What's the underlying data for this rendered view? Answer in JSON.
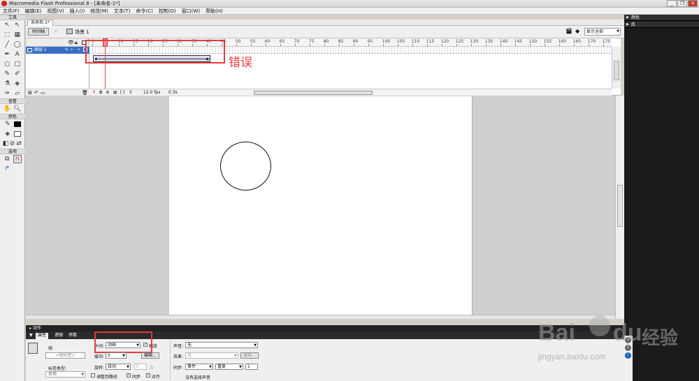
{
  "window": {
    "title": "Macromedia Flash Professional 8 - [未命名-1*]",
    "buttons": [
      "_",
      "❐",
      "✕"
    ]
  },
  "menu": [
    "文件(F)",
    "编辑(E)",
    "视图(V)",
    "插入(I)",
    "修改(M)",
    "文本(T)",
    "命令(C)",
    "控制(O)",
    "窗口(W)",
    "帮助(H)"
  ],
  "tools": {
    "title": "工具",
    "view_title": "查看",
    "colors_title": "颜色",
    "options_title": "选项",
    "rows": [
      [
        "arrow-icon",
        "subselect-icon"
      ],
      [
        "free-transform-icon",
        "fill-transform-icon"
      ],
      [
        "line-icon",
        "lasso-icon"
      ],
      [
        "pen-icon",
        "text-icon"
      ],
      [
        "oval-icon",
        "rectangle-icon"
      ],
      [
        "pencil-icon",
        "brush-icon"
      ],
      [
        "ink-bottle-icon",
        "paint-bucket-icon"
      ],
      [
        "eyedropper-icon",
        "eraser-icon"
      ]
    ],
    "row_glyphs": [
      [
        "↖",
        "↖"
      ],
      [
        "⬚",
        "▦"
      ],
      [
        "╱",
        "◯"
      ],
      [
        "✒",
        "A"
      ],
      [
        "○",
        "□"
      ],
      [
        "✎",
        "✐"
      ],
      [
        "⚗",
        "◈"
      ],
      [
        "✑",
        "▱"
      ]
    ]
  },
  "document": {
    "tab": "未命名-1*",
    "timeline_button": "时间轴",
    "scene_label": "场景 1",
    "zoom": "显示全部"
  },
  "timeline": {
    "layer_name": "图层 1",
    "ruler": [
      "1",
      "5",
      "10",
      "15",
      "20",
      "25",
      "30",
      "35",
      "40",
      "45",
      "50",
      "55",
      "60",
      "65",
      "70",
      "75",
      "80",
      "85",
      "90",
      "95",
      "100",
      "105",
      "110",
      "115",
      "120",
      "125",
      "130",
      "135",
      "140",
      "145",
      "150",
      "155",
      "160",
      "165",
      "170",
      "175"
    ],
    "current_frame": "5",
    "fps": "12.0 fps",
    "time": "0.3s",
    "annotation": "错误"
  },
  "panels": {
    "actions": "动作",
    "tabs": [
      "属性",
      "滤镜",
      "参数"
    ],
    "right": [
      "颜色",
      "库"
    ]
  },
  "properties": {
    "frame_label": "帧",
    "frame_name_placeholder": "<帧标签>",
    "label_type_label": "标签类型:",
    "label_type_value": "名称",
    "tween_label": "补间:",
    "tween_value": "动画",
    "scale_label": "缩放",
    "ease_label": "缓动:",
    "ease_value": "0",
    "edit_button": "编辑...",
    "rotate_label": "旋转:",
    "rotate_value": "自动",
    "rotate_count": "0",
    "rotate_unit": "次",
    "orient_path_label": "调整到路径",
    "sync_label": "同步",
    "snap_label": "对齐",
    "sound_label": "声音:",
    "sound_value": "无",
    "effect_label": "效果:",
    "effect_value": "无",
    "effect_edit_button": "编辑...",
    "sync2_label": "同步:",
    "sync_event": "事件",
    "sync_repeat": "重复",
    "sync_count": "1",
    "no_sound": "没有选择声音"
  },
  "watermark": {
    "brand_left": "Bai",
    "brand_right": "du",
    "brand_cn": "经验",
    "url": "jingyan.baidu.com"
  },
  "colors": {
    "accent": "#3a6ec2",
    "error_red": "#e53b3b",
    "tween_fill": "#dbdcf2",
    "stage": "#ffffff"
  }
}
